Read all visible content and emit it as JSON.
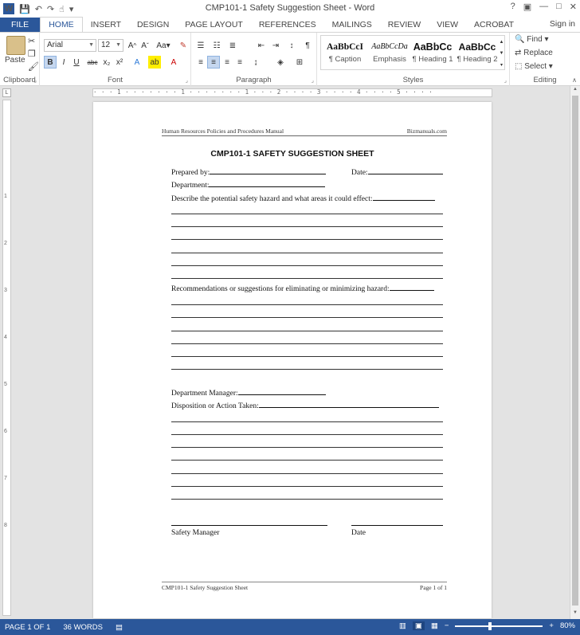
{
  "window": {
    "title": "CMP101-1 Safety Suggestion Sheet - Word",
    "qat_icons": [
      "word-logo-icon",
      "save-icon",
      "undo-icon",
      "redo-icon",
      "touch-mode-icon",
      "customize-icon"
    ],
    "controls": [
      "?",
      "▣",
      "—",
      "□",
      "✕"
    ]
  },
  "tabs": [
    "FILE",
    "HOME",
    "INSERT",
    "DESIGN",
    "PAGE LAYOUT",
    "REFERENCES",
    "MAILINGS",
    "REVIEW",
    "VIEW",
    "ACROBAT"
  ],
  "active_tab": "HOME",
  "signin": "Sign in",
  "ribbon": {
    "clipboard": {
      "label": "Clipboard",
      "paste": "Paste"
    },
    "font": {
      "label": "Font",
      "family": "Arial",
      "size": "12"
    },
    "paragraph": {
      "label": "Paragraph"
    },
    "styles": {
      "label": "Styles",
      "items": [
        {
          "sample": "AaBbCcI",
          "name": "¶ Caption"
        },
        {
          "sample": "AaBbCcDa",
          "name": "Emphasis"
        },
        {
          "sample": "AaBbCc",
          "name": "¶ Heading 1"
        },
        {
          "sample": "AaBbCc",
          "name": "¶ Heading 2"
        }
      ]
    },
    "editing": {
      "label": "Editing",
      "find": "Find",
      "replace": "Replace",
      "select": "Select"
    }
  },
  "ruler": {
    "h_text": "· · · 1 · · · · · · · 1 · · · · · · · 1 · · · 2 · · · · 3 · · · · 4 · · · · 5 · · · ·",
    "v_numbers": [
      "1",
      "2",
      "3",
      "4",
      "5",
      "6",
      "7",
      "8"
    ]
  },
  "document": {
    "header_left": "Human Resources Policies and Procedures Manual",
    "header_right": "Bizmanuals.com",
    "title": "CMP101-1 SAFETY SUGGESTION SHEET",
    "prepared_by": "Prepared by:",
    "date": "Date:",
    "department": "Department:",
    "describe": "Describe the potential safety hazard and what areas it could effect:",
    "recommend": "Recommendations or suggestions for eliminating or minimizing hazard:",
    "dept_manager": "Department Manager:",
    "disposition": "Disposition or Action Taken:",
    "safety_manager": "Safety Manager",
    "sig_date": "Date",
    "footer_left": "CMP101-1 Safety Suggestion Sheet",
    "footer_right": "Page 1 of 1"
  },
  "status": {
    "page": "PAGE 1 OF 1",
    "words": "36 WORDS",
    "zoom": "80%",
    "zoom_level": 0.8
  }
}
